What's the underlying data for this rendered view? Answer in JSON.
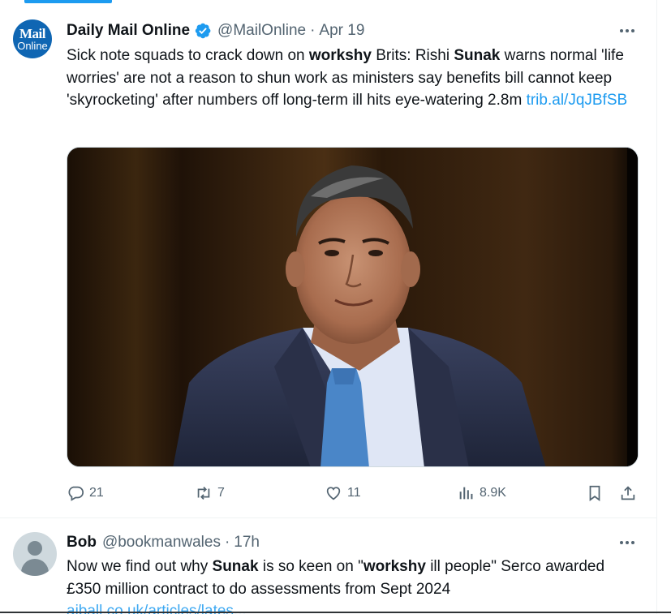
{
  "tweet1": {
    "avatar_text_top": "Mail",
    "avatar_text_bottom": "Online",
    "name": "Daily Mail Online",
    "handle": "@MailOnline",
    "separator": "·",
    "time": "Apr 19",
    "text": {
      "p1": "Sick note squads to crack down on ",
      "b1": "workshy",
      "p2": " Brits: Rishi ",
      "b2": "Sunak",
      "p3": " warns normal 'life worries' are not a reason to shun work as ministers say benefits bill cannot keep 'skyrocketing' after numbers off long-term ill hits eye-watering 2.8m ",
      "link": "trib.al/JqJBfSB"
    },
    "actions": {
      "replies": "21",
      "reposts": "7",
      "likes": "11",
      "views": "8.9K"
    }
  },
  "tweet2": {
    "name": "Bob",
    "handle": "@bookmanwales",
    "separator": "·",
    "time": "17h",
    "text": {
      "p1": "Now we find out why ",
      "b1": "Sunak",
      "p2": " is so keen on \"",
      "b2": "workshy",
      "p3": " ill people\" Serco awarded £350 million contract to do assessments from Sept 2024",
      "link": "aiball.co.uk/articles/lates..."
    }
  },
  "colors": {
    "accent": "#1d9bf0",
    "text_primary": "#0f1419",
    "text_secondary": "#536471",
    "mail_online_blue": "#0f66b3"
  },
  "icons": {
    "verified": "verified-badge-icon",
    "more": "more-dots-icon",
    "reply": "reply-bubble-icon",
    "repost": "repost-arrows-icon",
    "like": "heart-icon",
    "views": "bar-chart-icon",
    "bookmark": "bookmark-icon",
    "share": "share-upload-icon"
  }
}
